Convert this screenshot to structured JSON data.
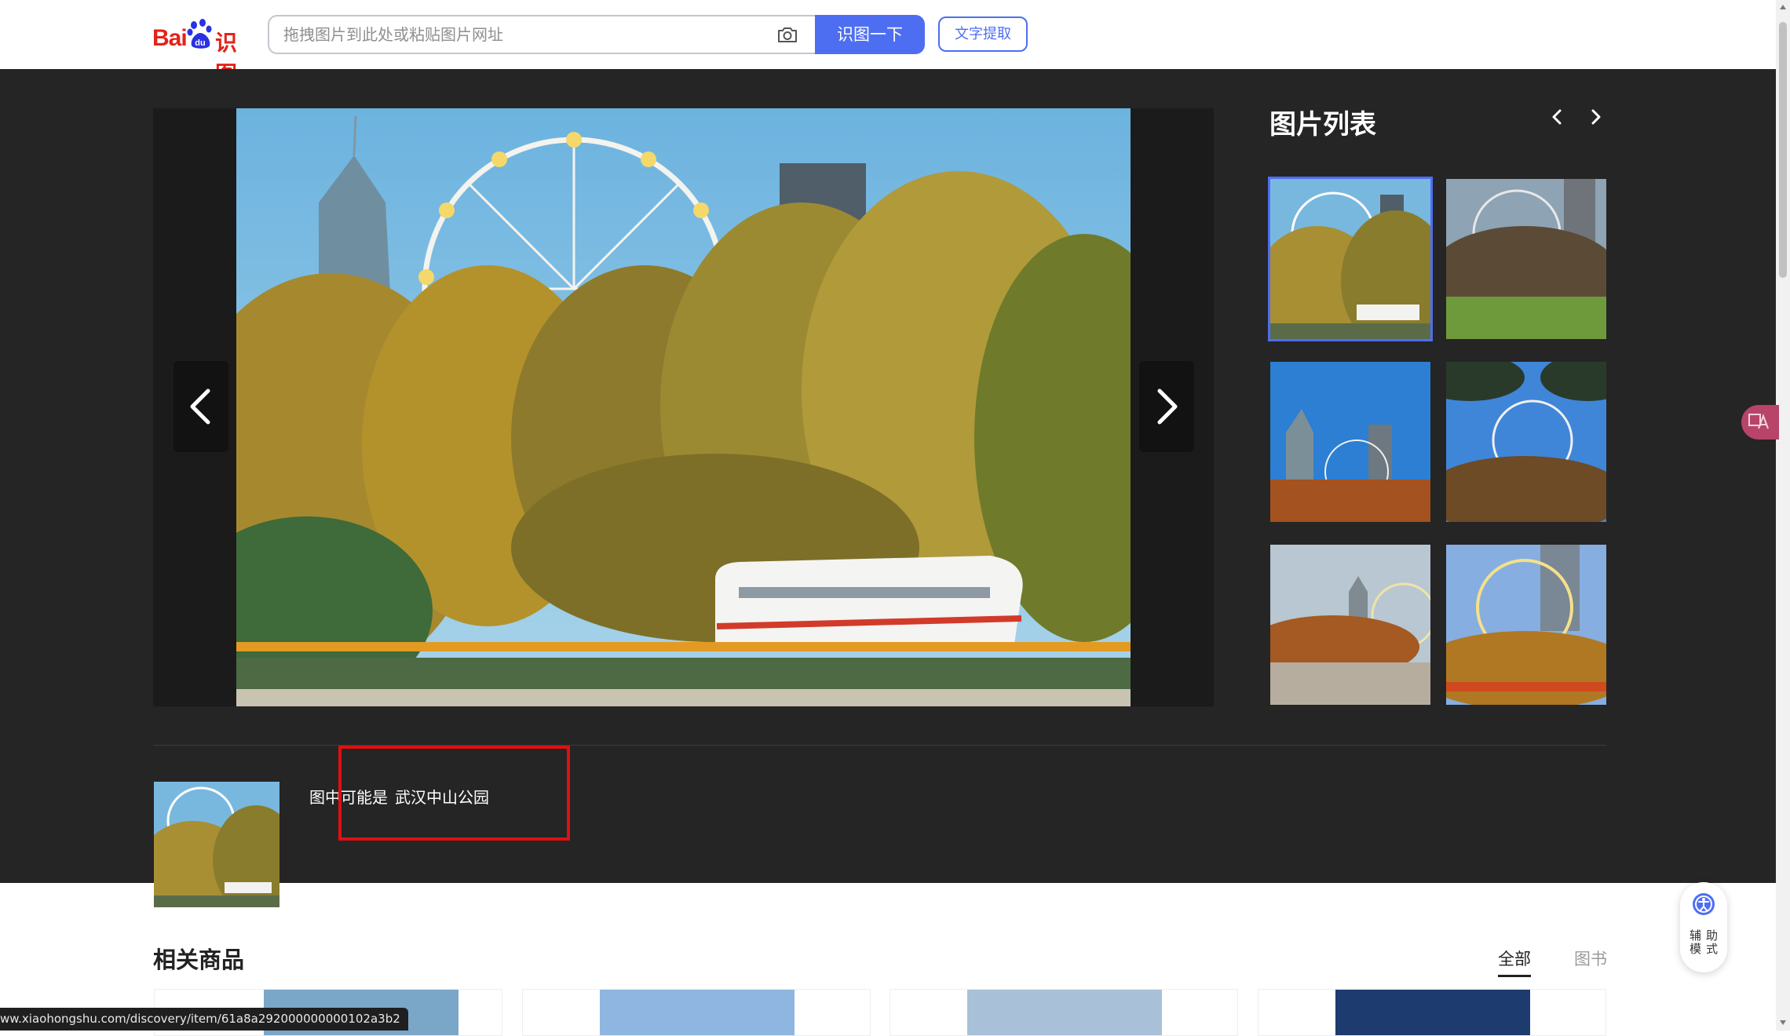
{
  "header": {
    "logo_text_latin": "Bai",
    "logo_text_paw": "du",
    "logo_text_cn": "识图",
    "search_placeholder": "拖拽图片到此处或粘贴图片网址",
    "search_button": "识图一下",
    "text_extract_button": "文字提取"
  },
  "image_list": {
    "title": "图片列表"
  },
  "result": {
    "prefix": "图中可能是",
    "name": "武汉中山公园"
  },
  "related": {
    "title": "相关商品",
    "tabs": [
      {
        "label": "全部",
        "active": true
      },
      {
        "label": "图书",
        "active": false
      }
    ]
  },
  "status_url": "ww.xiaohongshu.com/discovery/item/61a8a292000000000102a3b2",
  "assist": {
    "label_line1": "辅助",
    "label_line2": "模式"
  },
  "colors": {
    "accent": "#4e6ef2",
    "brand_red": "#e2231a",
    "dark_bg": "#252525",
    "highlight_box": "#e01010"
  }
}
